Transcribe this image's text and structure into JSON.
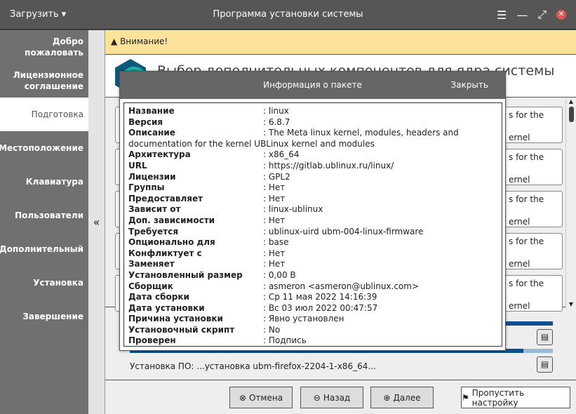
{
  "titlebar": {
    "load_label": "Загрузить ▾",
    "title": "Программа установки системы"
  },
  "sidebar": {
    "items": [
      "Добро пожаловать",
      "Лицензионное соглашение",
      "Подготовка",
      "Местоположение",
      "Клавиатура",
      "Пользователи",
      "Дополнительный",
      "Установка",
      "Завершение"
    ],
    "active": 2,
    "collapse": "«"
  },
  "warning": "Внимание!",
  "header_title": "Выбор дополнительных компонентов для ядра системы",
  "cards": [
    "s for the",
    "ernel",
    "s for the",
    "ernel",
    "s for the",
    "ernel",
    "s for the",
    "ernel",
    "s for the",
    "ernel"
  ],
  "install_status": "Установка ПО:   ...установка ubm-firefox-2204-1-x86_64...",
  "progress": {
    "top": 1.0,
    "bottom": 0.93
  },
  "buttons": {
    "cancel": "Отмена",
    "back": "Назад",
    "next": "Далее",
    "skip": "Пропустить настройку"
  },
  "dialog": {
    "title": "Информация о пакете",
    "close": "Закрыть",
    "rows": [
      [
        "Название",
        ": linux"
      ],
      [
        "Версия",
        ": 6.8.7"
      ],
      [
        "Описание",
        ": The Meta linux kernel, modules, headers and documentation for the kernel UBLinux kernel and modules"
      ],
      [
        "Архитектура",
        ": x86_64"
      ],
      [
        "URL",
        ": https://gitlab.ublinux.ru/linux/"
      ],
      [
        "Лицензии",
        ": GPL2"
      ],
      [
        "Группы",
        ": Нет"
      ],
      [
        "Предоставляет",
        ": Нет"
      ],
      [
        "Зависит от",
        ": linux-ublinux"
      ],
      [
        "Доп. зависимости",
        ": Нет"
      ],
      [
        "Требуется",
        ": ublinux-uird  ubm-004-linux-firmware"
      ],
      [
        "Опционально для",
        ": base"
      ],
      [
        "Конфликтует с",
        ": Нет"
      ],
      [
        "Заменяет",
        ": Нет"
      ],
      [
        "Установленный размер",
        ": 0,00 B"
      ],
      [
        "Сборщик",
        ": asmeron <asmeron@ublinux.com>"
      ],
      [
        "Дата сборки",
        ": Ср 11 мая 2022 14:16:39"
      ],
      [
        "Дата установки",
        ": Вс 03 июл 2022 00:47:57"
      ],
      [
        "Причина установки",
        ": Явно установлен"
      ],
      [
        "Установочный скрипт",
        ": No"
      ],
      [
        "Проверен",
        ": Подпись"
      ]
    ]
  }
}
